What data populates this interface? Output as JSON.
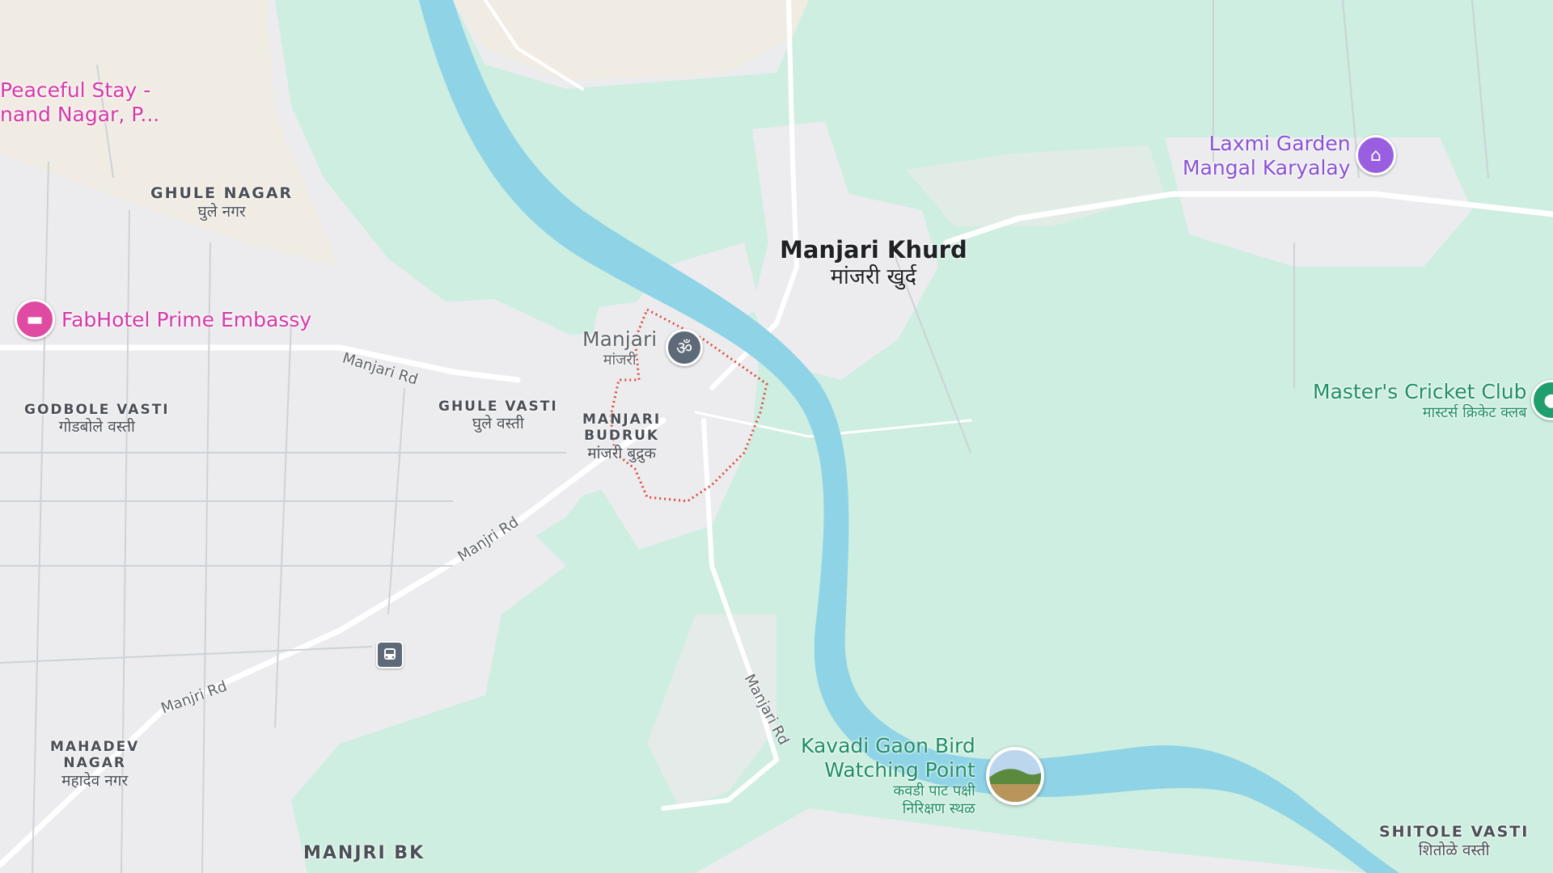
{
  "colors": {
    "land": "#ececef",
    "green": "#cdeee0",
    "river": "#8fd3e6",
    "road": "#ffffff",
    "boundary": "#e04a3c",
    "poi_pink": "#d63aa8",
    "poi_purple": "#8a52d6",
    "poi_green": "#1f8f67"
  },
  "places": {
    "ghule_nagar": {
      "name": "GHULE NAGAR",
      "local": "घुले नगर"
    },
    "godbole_vasti": {
      "name": "GODBOLE VASTI",
      "local": "गोडबोले वस्ती"
    },
    "ghule_vasti": {
      "name": "GHULE VASTI",
      "local": "घुले वस्ती"
    },
    "manjari_budruk": {
      "line1": "MANJARI",
      "line2": "BUDRUK",
      "local": "मांजरी बुद्रुक"
    },
    "mahadev_nagar": {
      "line1": "MAHADEV",
      "line2": "NAGAR",
      "local": "महादेव नगर"
    },
    "manjri_bk": {
      "name": "MANJRI BK"
    },
    "shitole_vasti": {
      "name": "SHITOLE VASTI",
      "local": "शितोळे वस्ती"
    },
    "manjari_khurd": {
      "name": "Manjari Khurd",
      "local": "मांजरी खुर्द"
    }
  },
  "pois": {
    "peaceful_stay": {
      "line1": "Peaceful Stay -",
      "line2": "nand Nagar, P..."
    },
    "fabhotel": {
      "name": "FabHotel Prime Embassy",
      "icon": "hotel-icon"
    },
    "manjari_temple": {
      "name": "Manjari",
      "local": "मांजरी",
      "icon": "om-temple-icon"
    },
    "laxmi_garden": {
      "line1": "Laxmi Garden",
      "line2": "Mangal Karyalay",
      "icon": "event-venue-icon"
    },
    "masters_cricket": {
      "name": "Master's Cricket Club",
      "local": "मास्टर्स क्रिकेट क्लब",
      "icon": "sports-icon"
    },
    "kavadi_bird": {
      "line1": "Kavadi Gaon Bird",
      "line2": "Watching Point",
      "local1": "कवडी पाट पक्षी",
      "local2": "निरिक्षण स्थळ",
      "icon": "photo-thumbnail"
    },
    "transit_stop": {
      "icon": "bus-stop-icon"
    }
  },
  "roads": {
    "manjari_rd_1": "Manjari Rd",
    "manjri_rd_2": "Manjri Rd",
    "manjri_rd_3": "Manjri Rd",
    "manjari_rd_4": "Manjari Rd"
  }
}
